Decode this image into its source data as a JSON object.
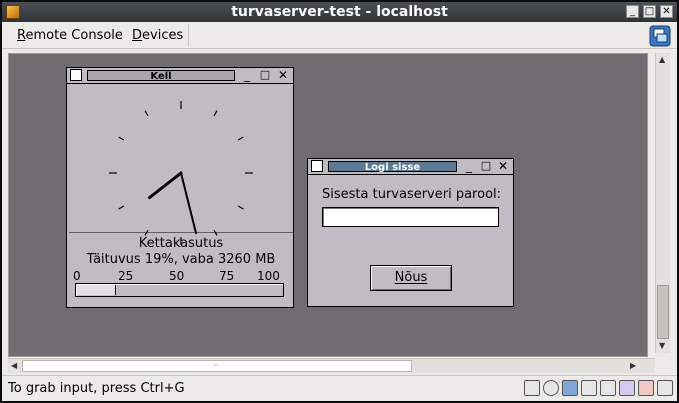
{
  "window": {
    "title": "turvaserver-test - localhost"
  },
  "menubar": {
    "items": [
      {
        "label": "Remote Console",
        "mnemonic_index": 0
      },
      {
        "label": "Devices",
        "mnemonic_index": 0
      }
    ]
  },
  "clock_window": {
    "title": "Kell",
    "clock": {
      "hour_hand_angle_deg": 232,
      "minute_hand_angle_deg": 166
    },
    "disk": {
      "heading": "Kettakasutus",
      "detail": "Täituvus 19%, vaba 3260 MB",
      "scale_labels": [
        "0",
        "25",
        "50",
        "75",
        "100"
      ],
      "usage_percent": 19
    }
  },
  "login_window": {
    "title": "Logi sisse",
    "prompt": "Sisesta turvaserveri parool:",
    "password_value": "",
    "button_label": "Nõus"
  },
  "statusbar": {
    "text": "To grab input, press Ctrl+G",
    "icons": [
      "mouse-integration-icon",
      "optical-drive-icon",
      "floppy-icon",
      "network-icon",
      "usb-icon",
      "shared-folders-icon",
      "recording-icon",
      "capture-icon"
    ]
  },
  "colors": {
    "desktop_bg": "#6f6d72",
    "xwin_bg": "#c0bcc4",
    "login_title_bg": "#5d7a93",
    "titlebar": "#2f3438"
  }
}
